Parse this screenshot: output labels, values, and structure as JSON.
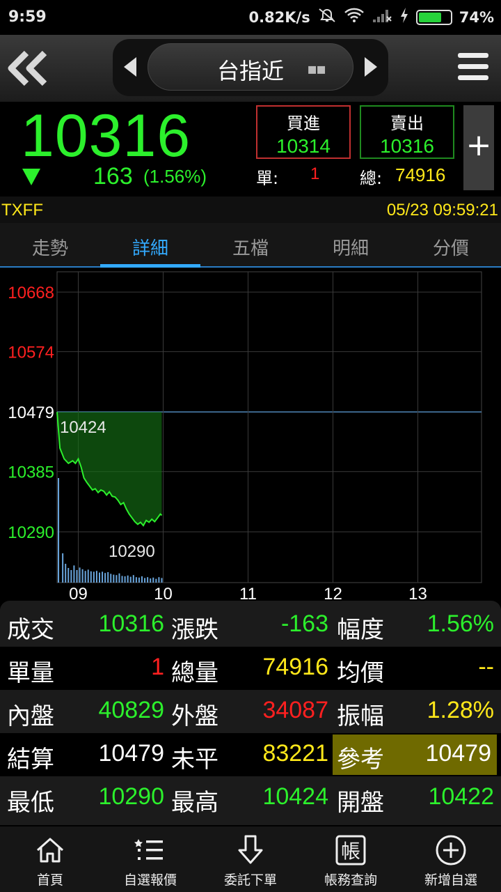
{
  "status_bar": {
    "time": "9:59",
    "network_speed": "0.82K/s",
    "battery": "74%",
    "battery_level": 0.74,
    "icons": [
      "mute-icon",
      "wifi-icon",
      "signal-icon",
      "charging-icon",
      "battery-icon"
    ]
  },
  "header": {
    "title": "台指近",
    "back_icon": "double-chevron-left-icon",
    "menu_icon": "hamburger-menu-icon"
  },
  "quote": {
    "last_price": "10316",
    "change": "163",
    "change_pct": "(1.56%)",
    "bid_label": "買進",
    "bid_value": "10314",
    "ask_label": "賣出",
    "ask_value": "10316",
    "unit_label": "單:",
    "unit_value": "1",
    "total_label": "總:",
    "total_value": "74916",
    "plus_label": "+"
  },
  "info": {
    "code": "TXFF",
    "datetime": "05/23 09:59:21"
  },
  "tabs": [
    {
      "label": "走勢"
    },
    {
      "label": "詳細"
    },
    {
      "label": "五檔"
    },
    {
      "label": "明細"
    },
    {
      "label": "分價"
    }
  ],
  "active_tab": "詳細",
  "chart_data": {
    "type": "line",
    "y_ticks": [
      "10668",
      "10574",
      "10479",
      "10385",
      "10290"
    ],
    "y_tick_values": [
      10668,
      10574,
      10479,
      10385,
      10290
    ],
    "x_ticks": [
      "09",
      "10",
      "11",
      "12",
      "13"
    ],
    "reference_line": 10479,
    "high_label": "10424",
    "low_label": "10290",
    "ylim": [
      10210,
      10700
    ],
    "x_range": [
      "08:45",
      "13:45"
    ],
    "series": [
      {
        "values": [
          [
            "08:45",
            10479
          ],
          [
            "08:47",
            10422
          ],
          [
            "08:50",
            10405
          ],
          [
            "08:53",
            10398
          ],
          [
            "08:56",
            10402
          ],
          [
            "08:58",
            10398
          ],
          [
            "09:00",
            10405
          ],
          [
            "09:02",
            10392
          ],
          [
            "09:04",
            10375
          ],
          [
            "09:06",
            10368
          ],
          [
            "09:08",
            10362
          ],
          [
            "09:10",
            10356
          ],
          [
            "09:12",
            10358
          ],
          [
            "09:14",
            10352
          ],
          [
            "09:16",
            10356
          ],
          [
            "09:18",
            10354
          ],
          [
            "09:20",
            10348
          ],
          [
            "09:22",
            10353
          ],
          [
            "09:24",
            10346
          ],
          [
            "09:26",
            10345
          ],
          [
            "09:28",
            10340
          ],
          [
            "09:30",
            10333
          ],
          [
            "09:32",
            10336
          ],
          [
            "09:34",
            10326
          ],
          [
            "09:36",
            10318
          ],
          [
            "09:38",
            10312
          ],
          [
            "09:40",
            10306
          ],
          [
            "09:42",
            10302
          ],
          [
            "09:44",
            10305
          ],
          [
            "09:46",
            10300
          ],
          [
            "09:48",
            10308
          ],
          [
            "09:50",
            10305
          ],
          [
            "09:52",
            10310
          ],
          [
            "09:54",
            10306
          ],
          [
            "09:56",
            10312
          ],
          [
            "09:58",
            10318
          ],
          [
            "09:59",
            10316
          ]
        ]
      }
    ],
    "volume": [
      [
        "08:46",
        5000
      ],
      [
        "08:49",
        1400
      ],
      [
        "08:51",
        900
      ],
      [
        "08:53",
        700
      ],
      [
        "08:55",
        600
      ],
      [
        "08:57",
        820
      ],
      [
        "08:59",
        600
      ],
      [
        "09:01",
        720
      ],
      [
        "09:03",
        640
      ],
      [
        "09:05",
        560
      ],
      [
        "09:07",
        620
      ],
      [
        "09:09",
        540
      ],
      [
        "09:11",
        520
      ],
      [
        "09:13",
        560
      ],
      [
        "09:15",
        480
      ],
      [
        "09:17",
        520
      ],
      [
        "09:19",
        460
      ],
      [
        "09:21",
        500
      ],
      [
        "09:23",
        420
      ],
      [
        "09:25",
        380
      ],
      [
        "09:27",
        360
      ],
      [
        "09:29",
        440
      ],
      [
        "09:31",
        320
      ],
      [
        "09:33",
        300
      ],
      [
        "09:35",
        340
      ],
      [
        "09:37",
        280
      ],
      [
        "09:39",
        360
      ],
      [
        "09:41",
        260
      ],
      [
        "09:43",
        240
      ],
      [
        "09:45",
        300
      ],
      [
        "09:47",
        220
      ],
      [
        "09:49",
        260
      ],
      [
        "09:51",
        200
      ],
      [
        "09:53",
        240
      ],
      [
        "09:55",
        180
      ],
      [
        "09:57",
        260
      ],
      [
        "09:59",
        220
      ]
    ]
  },
  "details": {
    "rows": [
      [
        {
          "label": "成交",
          "value": "10316",
          "color": "#2cf02c"
        },
        {
          "label": "漲跌",
          "value": "-163",
          "color": "#2cf02c"
        },
        {
          "label": "幅度",
          "value": "1.56%",
          "color": "#2cf02c"
        }
      ],
      [
        {
          "label": "單量",
          "value": "1",
          "color": "#ff2020"
        },
        {
          "label": "總量",
          "value": "74916",
          "color": "#ffe81a"
        },
        {
          "label": "均價",
          "value": "--",
          "color": "#ffe81a"
        }
      ],
      [
        {
          "label": "內盤",
          "value": "40829",
          "color": "#2cf02c"
        },
        {
          "label": "外盤",
          "value": "34087",
          "color": "#ff2020"
        },
        {
          "label": "振幅",
          "value": "1.28%",
          "color": "#ffe81a"
        }
      ],
      [
        {
          "label": "結算",
          "value": "10479",
          "color": "#ffffff"
        },
        {
          "label": "未平",
          "value": "83221",
          "color": "#ffe81a"
        },
        {
          "label": "參考",
          "value": "10479",
          "color": "#ffffff"
        }
      ],
      [
        {
          "label": "最低",
          "value": "10290",
          "color": "#2cf02c"
        },
        {
          "label": "最高",
          "value": "10424",
          "color": "#2cf02c"
        },
        {
          "label": "開盤",
          "value": "10422",
          "color": "#2cf02c"
        }
      ]
    ]
  },
  "bottom_nav": [
    {
      "label": "首頁",
      "icon": "home-icon"
    },
    {
      "label": "自選報價",
      "icon": "watchlist-icon"
    },
    {
      "label": "委託下單",
      "icon": "order-arrow-icon"
    },
    {
      "label": "帳務查詢",
      "icon": "account-icon",
      "glyph": "帳"
    },
    {
      "label": "新增自選",
      "icon": "add-circle-icon"
    }
  ],
  "colors": {
    "up": "#ff2020",
    "down": "#2cf02c",
    "neutral": "#ffe81a",
    "accent": "#33aaff"
  }
}
